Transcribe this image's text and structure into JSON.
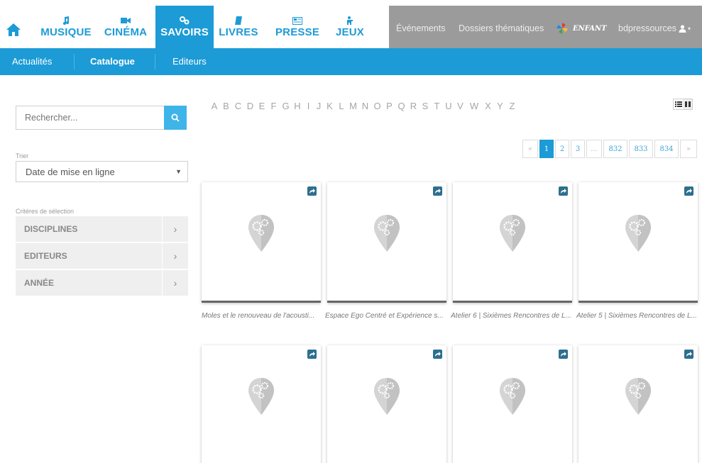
{
  "nav": {
    "home_icon": "home-icon",
    "items": [
      {
        "label": "MUSIQUE",
        "icon": "music-note-icon"
      },
      {
        "label": "CINÉMA",
        "icon": "camera-icon"
      },
      {
        "label": "SAVOIRS",
        "icon": "gears-icon",
        "active": true
      },
      {
        "label": "LIVRES",
        "icon": "book-icon"
      },
      {
        "label": "PRESSE",
        "icon": "newspaper-icon"
      },
      {
        "label": "JEUX",
        "icon": "game-figure-icon"
      }
    ],
    "secondary": {
      "evenements": "Événements",
      "dossiers": "Dossiers thématiques",
      "enfant": "ENFANT",
      "user": "bdpressources"
    },
    "colors": {
      "accent": "#1c9bd6",
      "gray_bar": "#9b9b9b"
    }
  },
  "subnav": {
    "items": [
      {
        "label": "Actualités"
      },
      {
        "label": "Catalogue",
        "active": true
      },
      {
        "label": "Editeurs"
      }
    ]
  },
  "sidebar": {
    "search_placeholder": "Rechercher...",
    "sort_label": "Trier",
    "sort_value": "Date de mise en ligne",
    "criteria_label": "Critères de sélection",
    "criteria": [
      "DISCIPLINES",
      "EDITEURS",
      "ANNÉE"
    ]
  },
  "alphabet": [
    "A",
    "B",
    "C",
    "D",
    "E",
    "F",
    "G",
    "H",
    "I",
    "J",
    "K",
    "L",
    "M",
    "N",
    "O",
    "P",
    "Q",
    "R",
    "S",
    "T",
    "U",
    "V",
    "W",
    "X",
    "Y",
    "Z"
  ],
  "pagination": {
    "prev": "«",
    "pages": [
      "1",
      "2",
      "3",
      "...",
      "832",
      "833",
      "834"
    ],
    "current": "1",
    "next": "»"
  },
  "cards": [
    {
      "caption": "Moles et le renouveau de l'acousti..."
    },
    {
      "caption": "Espace Ego Centré et Expérience s..."
    },
    {
      "caption": "Atelier 6 | Sixièmes Rencontres de L..."
    },
    {
      "caption": "Atelier 5 | Sixièmes Rencontres de L..."
    },
    {
      "caption": ""
    },
    {
      "caption": ""
    },
    {
      "caption": ""
    },
    {
      "caption": ""
    }
  ]
}
